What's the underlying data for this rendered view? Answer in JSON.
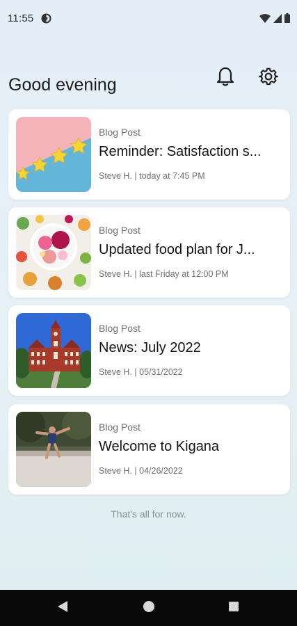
{
  "status": {
    "time": "11:55"
  },
  "header": {
    "greeting": "Good evening"
  },
  "posts": [
    {
      "category": "Blog Post",
      "title": "Reminder: Satisfaction s...",
      "meta": "Steve H. | today at 7:45 PM"
    },
    {
      "category": "Blog Post",
      "title": "Updated food plan for J...",
      "meta": "Steve H. | last Friday at 12:00 PM"
    },
    {
      "category": "Blog Post",
      "title": "News: July 2022",
      "meta": "Steve H. | 05/31/2022"
    },
    {
      "category": "Blog Post",
      "title": "Welcome to Kigana",
      "meta": "Steve H. | 04/26/2022"
    }
  ],
  "footer": {
    "end_message": "That's all for now."
  },
  "icons": {
    "notifications": "bell-icon",
    "settings": "gear-icon"
  }
}
